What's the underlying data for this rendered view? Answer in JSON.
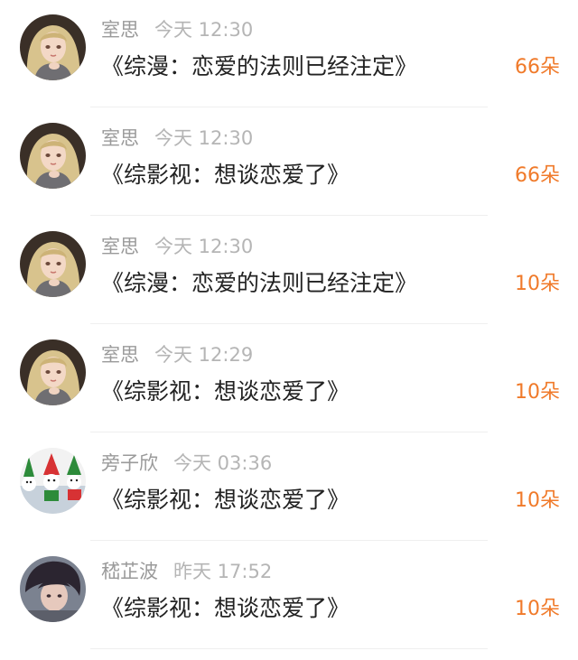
{
  "items": [
    {
      "name": "室思",
      "time": "今天 12:30",
      "title": "《综漫：恋爱的法则已经注定》",
      "count": "66朵"
    },
    {
      "name": "室思",
      "time": "今天 12:30",
      "title": "《综影视：想谈恋爱了》",
      "count": "66朵"
    },
    {
      "name": "室思",
      "time": "今天 12:30",
      "title": "《综漫：恋爱的法则已经注定》",
      "count": "10朵"
    },
    {
      "name": "室思",
      "time": "今天 12:29",
      "title": "《综影视：想谈恋爱了》",
      "count": "10朵"
    },
    {
      "name": "旁子欣",
      "time": "今天 03:36",
      "title": "《综影视：想谈恋爱了》",
      "count": "10朵"
    },
    {
      "name": "嵇芷波",
      "time": "昨天 17:52",
      "title": "《综影视：想谈恋爱了》",
      "count": "10朵"
    }
  ],
  "colors": {
    "count": "#f07a2a",
    "name": "#9a9a9a",
    "time": "#b5b5b5",
    "title": "#222222"
  },
  "icons": {
    "avatar_1": "anime-girl-avatar",
    "avatar_5": "christmas-dolls-avatar",
    "avatar_6": "dark-haired-person-avatar"
  }
}
